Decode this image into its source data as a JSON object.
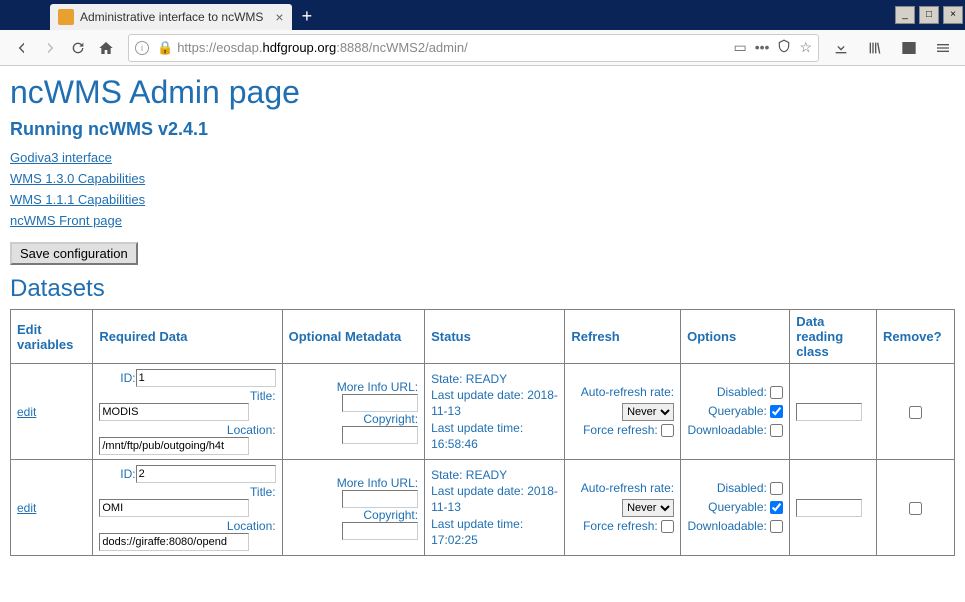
{
  "browser": {
    "tab_title": "Administrative interface to ncWMS",
    "url_display": "https://eosdap.hdfgroup.org:8888/ncWMS2/admin/",
    "url_host": "hdfgroup.org"
  },
  "page": {
    "title": "ncWMS Admin page",
    "version_heading": "Running ncWMS v2.4.1",
    "links": [
      "Godiva3 interface",
      "WMS 1.3.0 Capabilities",
      "WMS 1.1.1 Capabilities",
      "ncWMS Front page"
    ],
    "save_button": "Save configuration",
    "datasets_heading": "Datasets"
  },
  "table": {
    "headers": {
      "edit": "Edit variables",
      "required": "Required Data",
      "optional": "Optional Metadata",
      "status": "Status",
      "refresh": "Refresh",
      "options": "Options",
      "class": "Data reading class",
      "remove": "Remove?"
    },
    "labels": {
      "id": "ID:",
      "title": "Title:",
      "location": "Location:",
      "more_info": "More Info URL:",
      "copyright": "Copyright:",
      "auto_refresh": "Auto-refresh rate:",
      "force_refresh": "Force refresh:",
      "disabled": "Disabled:",
      "queryable": "Queryable:",
      "downloadable": "Downloadable:",
      "edit_link": "edit"
    },
    "refresh_options": [
      "Never"
    ],
    "rows": [
      {
        "id": "1",
        "title": "MODIS",
        "location": "/mnt/ftp/pub/outgoing/h4t",
        "more_info": "",
        "copyright": "",
        "status_state": "State: READY",
        "status_date_label": "Last update date:",
        "status_date": "2018-11-13",
        "status_time_label": "Last update time:",
        "status_time": "16:58:46",
        "refresh": "Never",
        "disabled": false,
        "queryable": true,
        "downloadable": false,
        "class": "",
        "remove": false
      },
      {
        "id": "2",
        "title": "OMI",
        "location": "dods://giraffe:8080/opend",
        "more_info": "",
        "copyright": "",
        "status_state": "State: READY",
        "status_date_label": "Last update date:",
        "status_date": "2018-11-13",
        "status_time_label": "Last update time:",
        "status_time": "17:02:25",
        "refresh": "Never",
        "disabled": false,
        "queryable": true,
        "downloadable": false,
        "class": "",
        "remove": false
      }
    ]
  }
}
